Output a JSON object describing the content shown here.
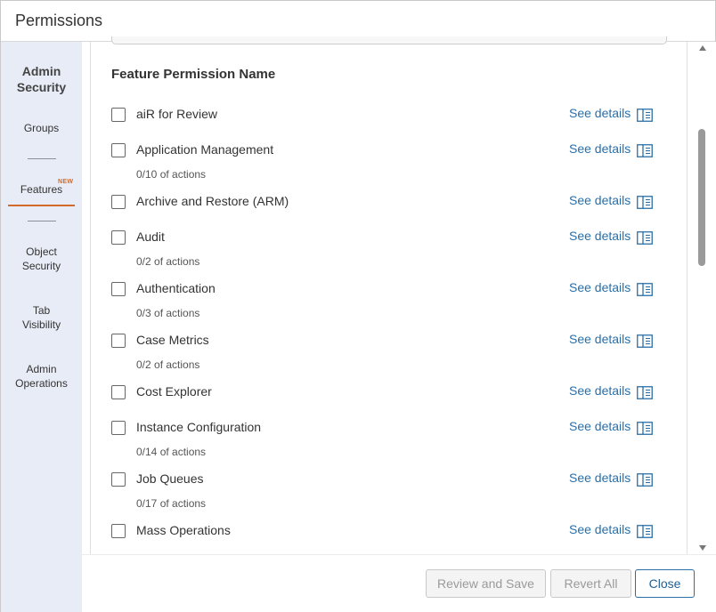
{
  "window": {
    "title": "Permissions"
  },
  "sidebar": {
    "heading": "Admin Security",
    "items": [
      {
        "label": "Groups",
        "active": false
      },
      {
        "label": "Features",
        "active": true,
        "badge": "NEW"
      },
      {
        "label": "Object Security",
        "active": false
      },
      {
        "label": "Tab Visibility",
        "active": false
      },
      {
        "label": "Admin Operations",
        "active": false
      }
    ]
  },
  "main": {
    "section_title": "Feature Permission Name",
    "link_label": "See details",
    "rows": [
      {
        "name": "aiR for Review",
        "sub": "",
        "checked": false
      },
      {
        "name": "Application Management",
        "sub": "0/10 of actions",
        "checked": false
      },
      {
        "name": "Archive and Restore (ARM)",
        "sub": "",
        "checked": false
      },
      {
        "name": "Audit",
        "sub": "0/2 of actions",
        "checked": false
      },
      {
        "name": "Authentication",
        "sub": "0/3 of actions",
        "checked": false
      },
      {
        "name": "Case Metrics",
        "sub": "0/2 of actions",
        "checked": false
      },
      {
        "name": "Cost Explorer",
        "sub": "",
        "checked": false
      },
      {
        "name": "Instance Configuration",
        "sub": "0/14 of actions",
        "checked": false
      },
      {
        "name": "Job Queues",
        "sub": "0/17 of actions",
        "checked": false
      },
      {
        "name": "Mass Operations",
        "sub": "",
        "checked": false
      }
    ]
  },
  "footer": {
    "review_save": "Review and Save",
    "revert_all": "Revert All",
    "close": "Close"
  },
  "colors": {
    "accent": "#d46a2a",
    "link": "#2a6fa8",
    "sidebar_bg": "#e8ecf6"
  },
  "icons": {
    "details": "book-panel-icon",
    "scroll_up": "caret-up-icon",
    "scroll_down": "caret-down-icon"
  }
}
